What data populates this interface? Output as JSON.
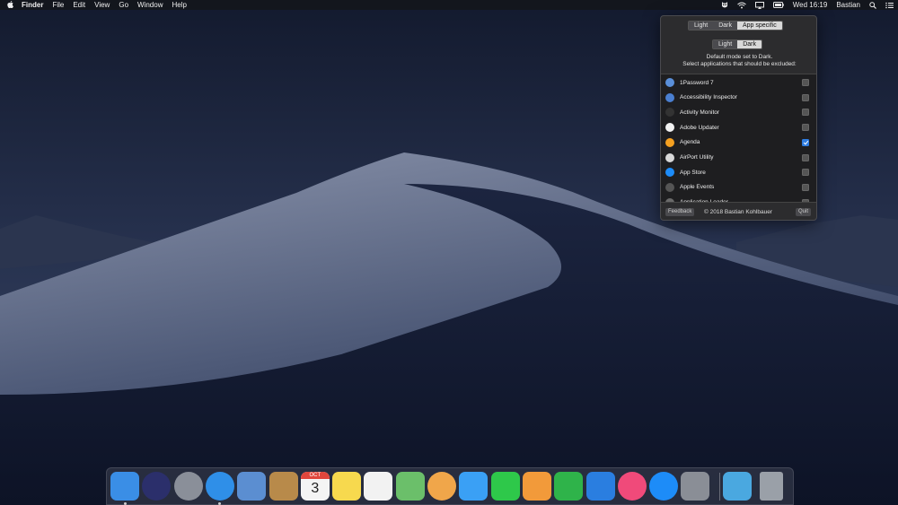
{
  "menubar": {
    "apple_icon": "apple-logo-icon",
    "app_name": "Finder",
    "menus": [
      "File",
      "Edit",
      "View",
      "Go",
      "Window",
      "Help"
    ],
    "clock": "Wed 16:19",
    "user": "Bastian",
    "status_icons": [
      "night-owl-icon",
      "wifi-icon",
      "airplay-icon",
      "battery-icon",
      "spotlight-icon",
      "notification-center-icon"
    ]
  },
  "popover": {
    "tabs": [
      "Light",
      "Dark",
      "App specific"
    ],
    "selected_tab": "App specific",
    "mode_options": [
      "Light",
      "Dark"
    ],
    "selected_mode": "Dark",
    "info_line1": "Default mode set to Dark.",
    "info_line2": "Select applications that should be excluded:",
    "apps": [
      {
        "name": "1Password 7",
        "icon": "1password-icon",
        "checked": false,
        "color": "#5a8fd8"
      },
      {
        "name": "Accessibility Inspector",
        "icon": "accessibility-inspector-icon",
        "checked": false,
        "color": "#4a7fd0"
      },
      {
        "name": "Activity Monitor",
        "icon": "activity-monitor-icon",
        "checked": false,
        "color": "#333333"
      },
      {
        "name": "Adobe Updater",
        "icon": "adobe-updater-icon",
        "checked": false,
        "color": "#f2f2f2"
      },
      {
        "name": "Agenda",
        "icon": "agenda-icon",
        "checked": true,
        "color": "#f4a020"
      },
      {
        "name": "AirPort Utility",
        "icon": "airport-utility-icon",
        "checked": false,
        "color": "#d8d8d8"
      },
      {
        "name": "App Store",
        "icon": "app-store-icon",
        "checked": false,
        "color": "#1d8cf8"
      },
      {
        "name": "Apple Events",
        "icon": "apple-events-icon",
        "checked": false,
        "color": "#555555"
      },
      {
        "name": "Application Loader",
        "icon": "application-loader-icon",
        "checked": false,
        "color": "#6a6a6a"
      }
    ],
    "feedback_label": "Feedback",
    "copyright": "© 2018 Bastian Kohlbauer",
    "quit_label": "Quit"
  },
  "dock": {
    "items": [
      {
        "name": "finder-icon",
        "color": "#3a8ee6",
        "running": true
      },
      {
        "name": "siri-icon",
        "color": "#2b2f6b",
        "running": false
      },
      {
        "name": "launchpad-icon",
        "color": "#8a8f99",
        "running": false
      },
      {
        "name": "safari-icon",
        "color": "#2f8fe8",
        "running": true
      },
      {
        "name": "mail-icon",
        "color": "#5b8ed1",
        "running": false
      },
      {
        "name": "contacts-icon",
        "color": "#b88a4a",
        "running": false
      },
      {
        "name": "calendar-icon",
        "color": "#f4f4f4",
        "running": false
      },
      {
        "name": "notes-icon",
        "color": "#f7d94e",
        "running": false
      },
      {
        "name": "reminders-icon",
        "color": "#f2f2f2",
        "running": false
      },
      {
        "name": "maps-icon",
        "color": "#6bbf6a",
        "running": false
      },
      {
        "name": "photos-icon",
        "color": "#f0a64a",
        "running": false
      },
      {
        "name": "messages-icon",
        "color": "#3aa0f5",
        "running": false
      },
      {
        "name": "facetime-icon",
        "color": "#2ec84a",
        "running": false
      },
      {
        "name": "pages-icon",
        "color": "#f29a3a",
        "running": false
      },
      {
        "name": "numbers-icon",
        "color": "#2fb34a",
        "running": false
      },
      {
        "name": "keynote-icon",
        "color": "#2a7ee0",
        "running": false
      },
      {
        "name": "itunes-icon",
        "color": "#f04a7a",
        "running": false
      },
      {
        "name": "app-store-dock-icon",
        "color": "#1d8cf8",
        "running": false
      },
      {
        "name": "system-preferences-icon",
        "color": "#8a8e96",
        "running": false
      },
      {
        "name": "downloads-folder-icon",
        "color": "#4aa8e0",
        "running": false
      },
      {
        "name": "trash-icon",
        "color": "#9aa0a8",
        "running": false
      }
    ],
    "calendar_month": "OCT",
    "calendar_day": "3"
  }
}
